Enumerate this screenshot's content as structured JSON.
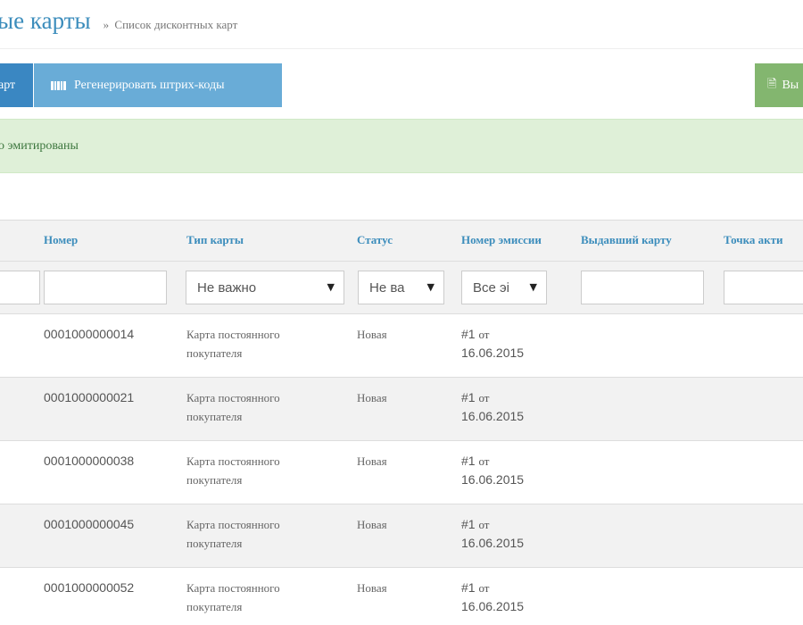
{
  "header": {
    "title": "ые карты",
    "breadcrumb_arrow": "»",
    "breadcrumb": "Список дисконтных карт"
  },
  "toolbar": {
    "emit_label": "арт",
    "regen_label": "Регенерировать штрих-коды",
    "regen_icon": "barcode-icon",
    "export_label": "Вы",
    "export_icon": "document-icon"
  },
  "alert": {
    "text": "о эмитированы"
  },
  "table": {
    "columns": [
      "Номер",
      "Тип карты",
      "Статус",
      "Номер эмиссии",
      "Выдавший карту",
      "Точка акти"
    ],
    "filters": {
      "type_selected": "Не важно",
      "status_selected": "Не ва",
      "emission_selected": "Все эі"
    },
    "rows": [
      {
        "number": "0001000000014",
        "type": "Карта постоянного покупателя",
        "status": "Новая",
        "emission_no": "#1",
        "emission_ot": "от",
        "emission_date": "16.06.2015",
        "issuer": "",
        "activation": ""
      },
      {
        "number": "0001000000021",
        "type": "Карта постоянного покупателя",
        "status": "Новая",
        "emission_no": "#1",
        "emission_ot": "от",
        "emission_date": "16.06.2015",
        "issuer": "",
        "activation": ""
      },
      {
        "number": "0001000000038",
        "type": "Карта постоянного покупателя",
        "status": "Новая",
        "emission_no": "#1",
        "emission_ot": "от",
        "emission_date": "16.06.2015",
        "issuer": "",
        "activation": ""
      },
      {
        "number": "0001000000045",
        "type": "Карта постоянного покупателя",
        "status": "Новая",
        "emission_no": "#1",
        "emission_ot": "от",
        "emission_date": "16.06.2015",
        "issuer": "",
        "activation": ""
      },
      {
        "number": "0001000000052",
        "type": "Карта постоянного покупателя",
        "status": "Новая",
        "emission_no": "#1",
        "emission_ot": "от",
        "emission_date": "16.06.2015",
        "issuer": "",
        "activation": ""
      }
    ]
  },
  "colors": {
    "primary": "#3c8dbc",
    "button_primary": "#3a87c2",
    "button_info": "#69acd7",
    "button_success": "#83b66f",
    "alert_bg": "#dff0d8",
    "alert_text": "#3c763d"
  }
}
